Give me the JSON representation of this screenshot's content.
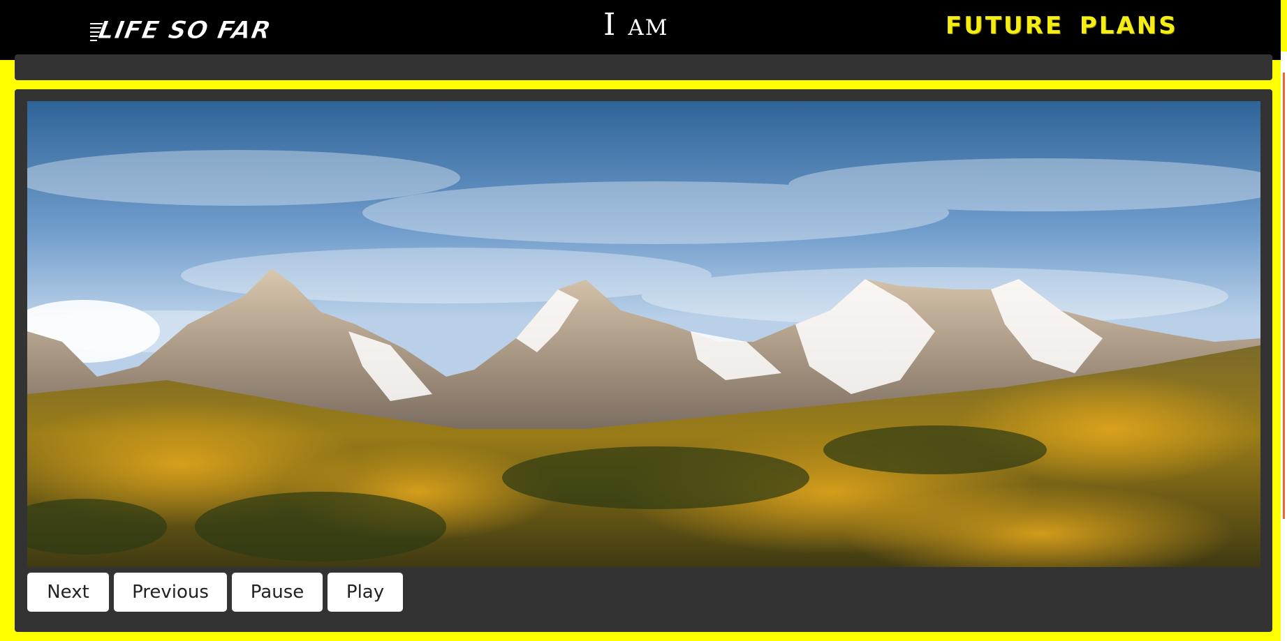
{
  "nav": {
    "left_label": "Life So Far",
    "center_label": "I am",
    "right_label": "Future Plans"
  },
  "slideshow": {
    "buttons": {
      "next": "Next",
      "previous": "Previous",
      "pause": "Pause",
      "play": "Play"
    }
  },
  "colors": {
    "page_background": "#ffff00",
    "nav_background": "#000000",
    "panel_background": "#333333",
    "future_plans_text": "#f5ee15",
    "button_background": "#ffffff",
    "edge_accent": "#f1642a"
  }
}
